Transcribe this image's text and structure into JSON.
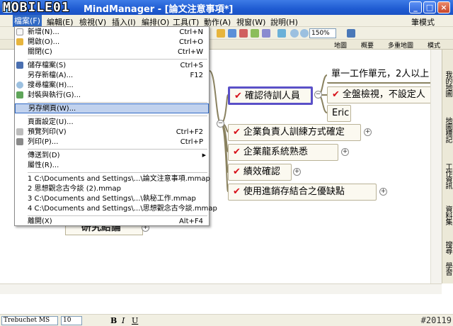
{
  "window": {
    "title": "MindManager - [論文注意事項*]",
    "logo": "MOBILE01"
  },
  "menubar": {
    "items": [
      "檔案(F)",
      "編輯(E)",
      "檢視(V)",
      "插入(I)",
      "編排(O)",
      "工具(T)",
      "動作(A)",
      "視窗(W)",
      "說明(H)"
    ],
    "mode": "筆模式"
  },
  "toolbar": {
    "zoom": "150%"
  },
  "viewbar": {
    "tabs": [
      "地圖",
      "概要",
      "多重地圖",
      "模式"
    ]
  },
  "file_menu": {
    "items": [
      {
        "label": "新增(N)...",
        "shortcut": "Ctrl+N"
      },
      {
        "label": "開啟(O)...",
        "shortcut": "Ctrl+O"
      },
      {
        "label": "關閉(C)",
        "shortcut": "Ctrl+W"
      },
      {
        "label": "儲存檔案(S)",
        "shortcut": "Ctrl+S"
      },
      {
        "label": "另存新檔(A)...",
        "shortcut": "F12"
      },
      {
        "label": "搜尋檔案(H)...",
        "shortcut": ""
      },
      {
        "label": "封裝與執行(G)...",
        "shortcut": ""
      },
      {
        "label": "另存網頁(W)...",
        "shortcut": ""
      },
      {
        "label": "頁面設定(U)...",
        "shortcut": ""
      },
      {
        "label": "預覽列印(V)",
        "shortcut": "Ctrl+F2"
      },
      {
        "label": "列印(P)...",
        "shortcut": "Ctrl+P"
      },
      {
        "label": "傳送到(D)",
        "shortcut": ""
      },
      {
        "label": "屬性(R)...",
        "shortcut": ""
      },
      {
        "label": "1 C:\\Documents and Settings\\...\\論文注意事項.mmap",
        "shortcut": ""
      },
      {
        "label": "2 思想觀念古今談 (2).mmap",
        "shortcut": ""
      },
      {
        "label": "3 C:\\Documents and Settings\\...\\執秘工作.mmap",
        "shortcut": ""
      },
      {
        "label": "4 C:\\Documents and Settings\\...\\思想觀念古今談.mmap",
        "shortcut": ""
      },
      {
        "label": "離開(X)",
        "shortcut": "Alt+F4"
      }
    ]
  },
  "map": {
    "selected_topic": "確認待訓人員",
    "right_topics": [
      "單一工作單元，2人以上",
      "全盤檢視，不設定人",
      "Eric"
    ],
    "topics": [
      "企業負責人訓練方式確定",
      "企業龍系統熟悉",
      "績效確認",
      "使用進銷存結合之優缺點"
    ],
    "research": "研究結論"
  },
  "side_panel": {
    "tabs": [
      "我的地圖",
      "地圖標記",
      "工作資訊",
      "資料集",
      "搜尋",
      "學習"
    ]
  },
  "format_bar": {
    "font": "Trebuchet MS",
    "size": "10",
    "bold": "B",
    "italic": "I",
    "underline": "U"
  },
  "watermark": "#20119",
  "colors": {
    "title_bar": "#2a62d6",
    "selection": "#316ac5",
    "check": "#d7101a"
  }
}
